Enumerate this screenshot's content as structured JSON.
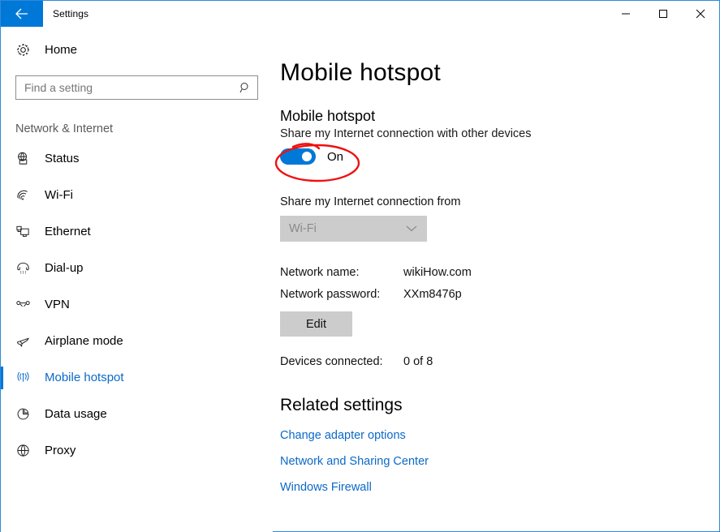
{
  "window": {
    "title": "Settings",
    "back_icon": "back-arrow-icon",
    "controls": {
      "minimize": "minimize-icon",
      "maximize": "maximize-icon",
      "close": "close-icon"
    },
    "accent_color": "#0078d7",
    "border_color": "#2e8ad8"
  },
  "sidebar": {
    "home": {
      "label": "Home",
      "icon": "gear-icon"
    },
    "search": {
      "placeholder": "Find a setting",
      "value": "",
      "icon": "search-icon"
    },
    "section_label": "Network & Internet",
    "items": [
      {
        "label": "Status",
        "icon": "globe-monitor-icon",
        "selected": false
      },
      {
        "label": "Wi-Fi",
        "icon": "wifi-icon",
        "selected": false
      },
      {
        "label": "Ethernet",
        "icon": "ethernet-icon",
        "selected": false
      },
      {
        "label": "Dial-up",
        "icon": "dialup-phone-icon",
        "selected": false
      },
      {
        "label": "VPN",
        "icon": "vpn-icon",
        "selected": false
      },
      {
        "label": "Airplane mode",
        "icon": "airplane-icon",
        "selected": false
      },
      {
        "label": "Mobile hotspot",
        "icon": "broadcast-icon",
        "selected": true
      },
      {
        "label": "Data usage",
        "icon": "pie-chart-icon",
        "selected": false
      },
      {
        "label": "Proxy",
        "icon": "globe-icon",
        "selected": false
      }
    ],
    "selected_color": "#0b69c7"
  },
  "main": {
    "page_title": "Mobile hotspot",
    "section": {
      "heading": "Mobile hotspot",
      "description": "Share my Internet connection with other devices",
      "toggle": {
        "state_label": "On",
        "on": true,
        "color": "#0078d7",
        "annotation": {
          "shape": "hand-drawn-ellipse",
          "color": "#ee1111"
        }
      }
    },
    "connection_source": {
      "label": "Share my Internet connection from",
      "value": "Wi-Fi",
      "disabled": true,
      "arrow_icon": "chevron-down-icon"
    },
    "details": [
      {
        "key": "Network name:",
        "value": "wikiHow.com"
      },
      {
        "key": "Network password:",
        "value": "XXm8476p"
      }
    ],
    "edit_button": "Edit",
    "devices": {
      "key": "Devices connected:",
      "value": "0 of 8"
    },
    "related": {
      "title": "Related settings",
      "links": [
        "Change adapter options",
        "Network and Sharing Center",
        "Windows Firewall"
      ],
      "link_color": "#0b69c7"
    }
  }
}
